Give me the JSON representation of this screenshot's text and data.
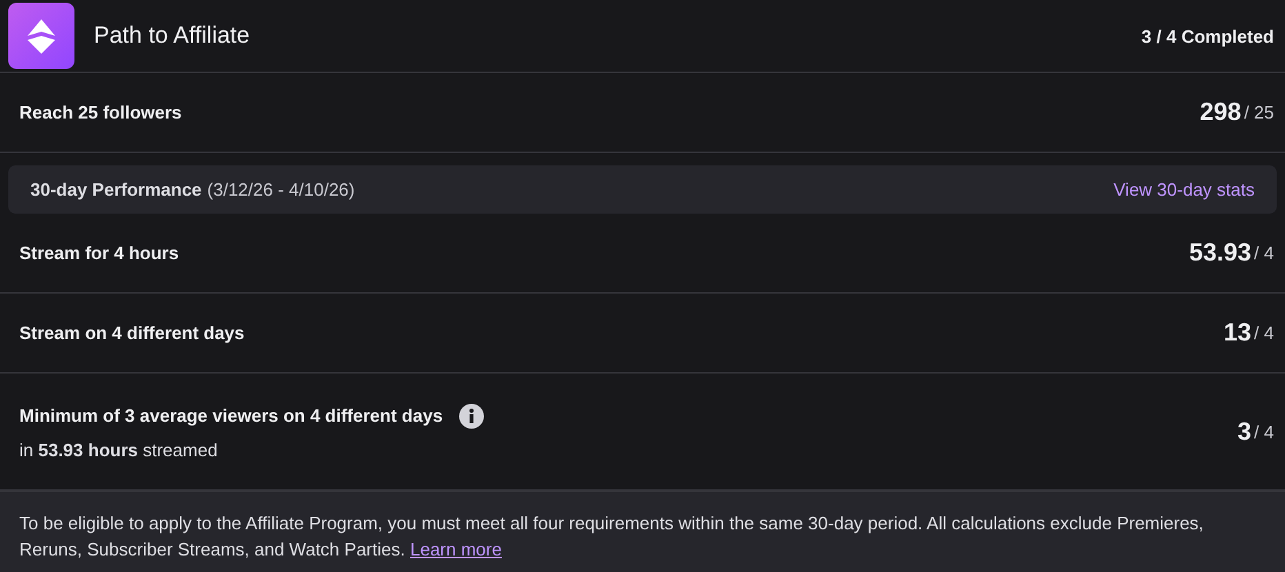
{
  "header": {
    "title": "Path to Affiliate",
    "progress": "3 / 4 Completed"
  },
  "follower_goal": {
    "label": "Reach 25 followers",
    "value": "298",
    "target": "/ 25"
  },
  "performance": {
    "title": "30-day Performance",
    "date_range": "(3/12/26 - 4/10/26)",
    "link": "View 30-day stats"
  },
  "requirements": [
    {
      "label": "Stream for 4 hours",
      "value": "53.93",
      "target": "/ 4",
      "info": false
    },
    {
      "label": "Stream on 4 different days",
      "value": "13",
      "target": "/ 4",
      "info": false
    },
    {
      "label": "Minimum of 3 average viewers on 4 different days",
      "value": "3",
      "target": "/ 4",
      "info": true,
      "note": "in **53.93 hours** streamed"
    }
  ],
  "footer": {
    "text": "To be eligible to apply to the Affiliate Program, you must meet all four requirements within the same 30-day period. All calculations exclude Premieres, Reruns, Subscriber Streams, and Watch Parties.",
    "link": "Learn more"
  }
}
